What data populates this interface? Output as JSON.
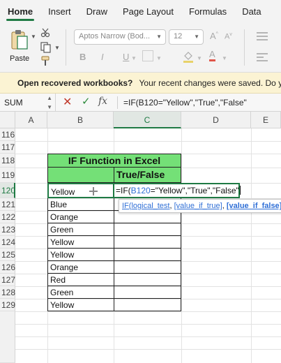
{
  "ribbon": {
    "tabs": [
      "Home",
      "Insert",
      "Draw",
      "Page Layout",
      "Formulas",
      "Data"
    ],
    "active_tab": "Home",
    "paste_label": "Paste",
    "font_name": "Aptos Narrow (Bod...",
    "font_size": "12",
    "grow_label": "A",
    "shrink_label": "A",
    "bold_label": "B",
    "italic_label": "I",
    "underline_label": "U",
    "font_color_label": "A",
    "accent_color": "#1f7a44"
  },
  "notification": {
    "title": "Open recovered workbooks?",
    "message": "Your recent changes were saved. Do yo"
  },
  "formula_bar": {
    "name_box": "SUM",
    "cancel_label": "✕",
    "enter_label": "✓",
    "fx_label": "fx",
    "formula": "=IF(B120=\"Yellow\",\"True\",\"False\""
  },
  "grid": {
    "columns": [
      "A",
      "B",
      "C",
      "D",
      "E"
    ],
    "selected_column": "C",
    "rows": [
      "116",
      "117",
      "118",
      "119",
      "120",
      "121",
      "122",
      "123",
      "124",
      "125",
      "126",
      "127",
      "128",
      "129"
    ],
    "selected_row": "120"
  },
  "table": {
    "title": "IF Function in Excel",
    "header": "True/False",
    "header_color": "#74e077",
    "values": [
      "Yellow",
      "Blue",
      "Orange",
      "Green",
      "Yellow",
      "Yellow",
      "Orange",
      "Red",
      "Green",
      "Yellow"
    ]
  },
  "editing_cell": {
    "prefix": "=IF(",
    "ref": "B120",
    "suffix": "=\"Yellow\",\"True\",\"False\""
  },
  "tooltip": {
    "fn": "IF(",
    "arg1": "logical_test",
    "sep1": ", ",
    "arg2": "[value_if_true]",
    "sep2": ", ",
    "arg3": "[value_if_false]"
  }
}
